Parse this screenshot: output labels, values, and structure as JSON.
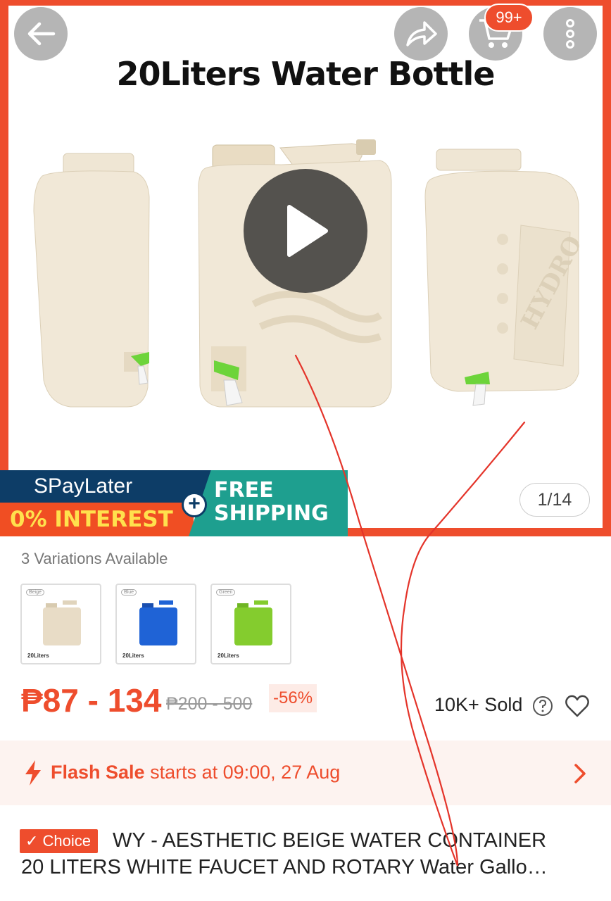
{
  "hero": {
    "title": "20Liters Water Bottle",
    "cart_badge": "99+",
    "pager": "1/14",
    "banner": {
      "paylater": "SPayLater",
      "interest": "0% INTEREST",
      "shipping_line1": "FREE",
      "shipping_line2": "SHIPPING"
    },
    "icons": [
      "back-arrow-icon",
      "share-icon",
      "cart-icon",
      "more-icon",
      "play-icon"
    ]
  },
  "variations": {
    "label": "3 Variations Available",
    "items": [
      {
        "tag": "Beige",
        "caption": "20Liters",
        "color": "#e8dcc6"
      },
      {
        "tag": "Blue",
        "caption": "20Liters",
        "color": "#1f63d6"
      },
      {
        "tag": "Green",
        "caption": "20Liters",
        "color": "#84cc2e"
      }
    ]
  },
  "price": {
    "range": "₱87 - 134",
    "original": "₱200 - 500",
    "discount": "-56%",
    "sold": "10K+ Sold"
  },
  "flash_sale": {
    "label": "Flash Sale",
    "text": " starts at 09:00, 27 Aug"
  },
  "product": {
    "badge": "✓ Choice",
    "title_line1": "WY - AESTHETIC BEIGE WATER CONTAINER",
    "title_line2": "20 LITERS WHITE FAUCET AND ROTARY Water Gallo…"
  },
  "colors": {
    "accent": "#ee4d2d",
    "paylater_navy": "#0d3d67",
    "shipping_teal": "#1e9f8f"
  }
}
